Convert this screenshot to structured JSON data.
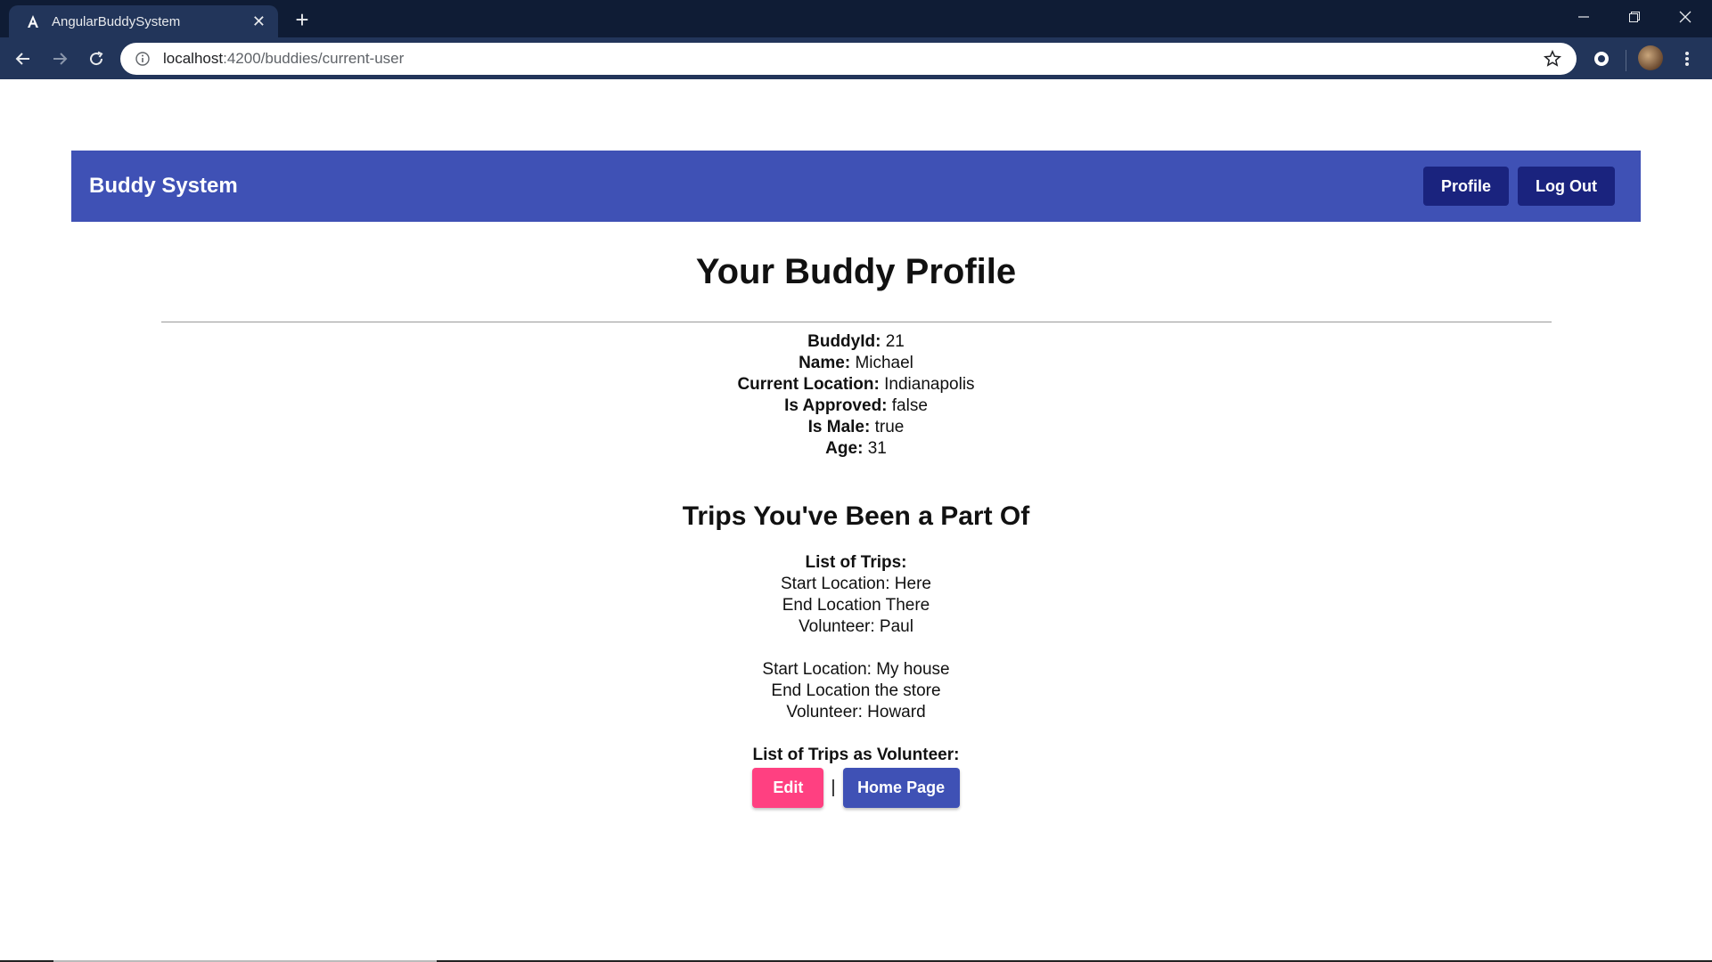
{
  "browser": {
    "tab_title": "AngularBuddySystem",
    "url_host": "localhost",
    "url_path": ":4200/buddies/current-user"
  },
  "navbar": {
    "brand": "Buddy System",
    "profile_label": "Profile",
    "logout_label": "Log Out",
    "color": "#3f51b5",
    "button_color": "#1a237e"
  },
  "profile": {
    "title": "Your Buddy Profile",
    "fields": [
      {
        "label": "BuddyId:",
        "value": "21"
      },
      {
        "label": "Name:",
        "value": "Michael"
      },
      {
        "label": "Current Location:",
        "value": "Indianapolis"
      },
      {
        "label": "Is Approved:",
        "value": "false"
      },
      {
        "label": "Is Male:",
        "value": "true"
      },
      {
        "label": "Age:",
        "value": "31"
      }
    ]
  },
  "trips": {
    "title": "Trips You've Been a Part Of",
    "list_label": "List of Trips:",
    "items": [
      {
        "start": "Start Location: Here",
        "end": "End Location There",
        "volunteer": "Volunteer: Paul"
      },
      {
        "start": "Start Location: My house",
        "end": "End Location the store",
        "volunteer": "Volunteer: Howard"
      }
    ],
    "volunteer_label": "List of Trips as Volunteer:"
  },
  "actions": {
    "edit_label": "Edit",
    "separator": "|",
    "home_label": "Home Page",
    "edit_color": "#ff4081",
    "home_color": "#3f51b5"
  }
}
